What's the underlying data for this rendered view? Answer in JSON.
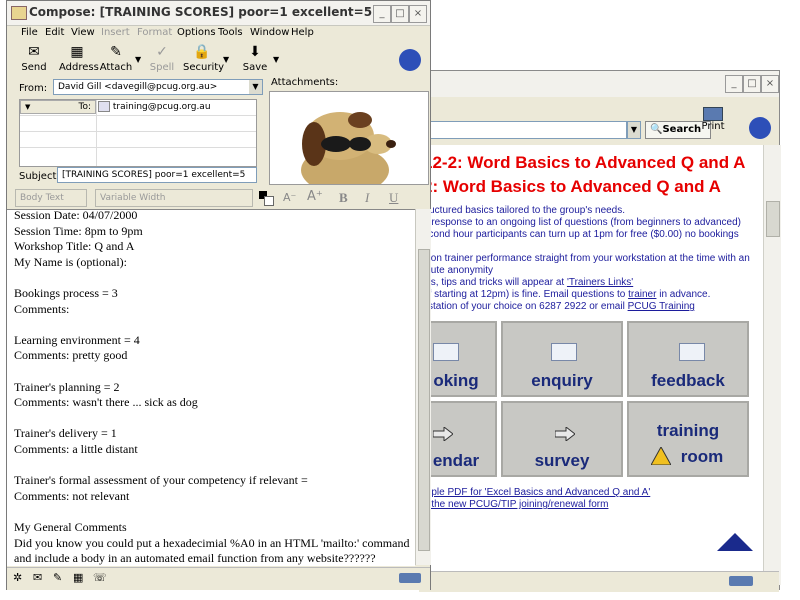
{
  "browser": {
    "search_label": "Search",
    "print_label": "Print",
    "headings": [
      "12-2: Word Basics to Advanced Q and A",
      "2: Word Basics to Advanced Q and A"
    ],
    "desc_lines": [
      "tructured basics tailored to the group's needs.",
      "a response to an ongoing list of questions (from beginners to advanced)",
      "econd hour participants can turn up at 1pm for free ($0.00) no bookings",
      "d",
      "k on trainer performance straight from your workstation at the time with an",
      "olute anonymity",
      "als, tips and tricks will appear at ",
      "(if starting at 12pm) is fine.  Email questions to ",
      "kstation of your choice on 6287 2922 or email "
    ],
    "link_trainers": "'Trainers Links'",
    "link_trainer": "trainer",
    "after_trainer": " in advance.",
    "link_pcug": "PCUG Training",
    "tiles": [
      "oking",
      "enquiry",
      "feedback",
      "endar",
      "survey",
      "training",
      "room"
    ],
    "footer_links": [
      "mple PDF for 'Excel Basics and Advanced Q and A'",
      "d the new PCUG/TIP joining/renewal form"
    ]
  },
  "compose": {
    "title": "Compose: [TRAINING SCORES] poor=1 excellent=5",
    "menu": [
      "File",
      "Edit",
      "View",
      "Insert",
      "Format",
      "Options",
      "Tools",
      "Window",
      "Help"
    ],
    "toolbar": [
      "Send",
      "Address",
      "Attach",
      "Spell",
      "Security",
      "Save"
    ],
    "from_label": "From:",
    "from_value": "David Gill <davegill@pcug.org.au>",
    "to_label": "To:",
    "to_value": "training@pcug.org.au",
    "attachments_label": "Attachments:",
    "subject_label": "Subject:",
    "subject_value": "[TRAINING SCORES] poor=1 excellent=5",
    "format_style": "Body Text",
    "format_font": "Variable Width",
    "body_lines": [
      "Session Date: 04/07/2000",
      "Session Time: 8pm to 9pm",
      "Workshop Title: Q and A",
      "My Name is (optional):",
      "",
      "Bookings process = 3",
      "Comments:",
      "",
      "Learning environment = 4",
      "Comments: pretty good",
      "",
      "Trainer's planning = 2",
      "Comments: wasn't there ... sick as  dog",
      "",
      "Trainer's delivery = 1",
      "Comments: a little distant",
      "",
      "Trainer's formal assessment of your competency if relevant =",
      "Comments: not relevant",
      "",
      "My General Comments",
      "Did you know you could put a hexadecimial %A0 in an HTML 'mailto:' command",
      "and include a body in an automated email function from any website??????"
    ]
  }
}
